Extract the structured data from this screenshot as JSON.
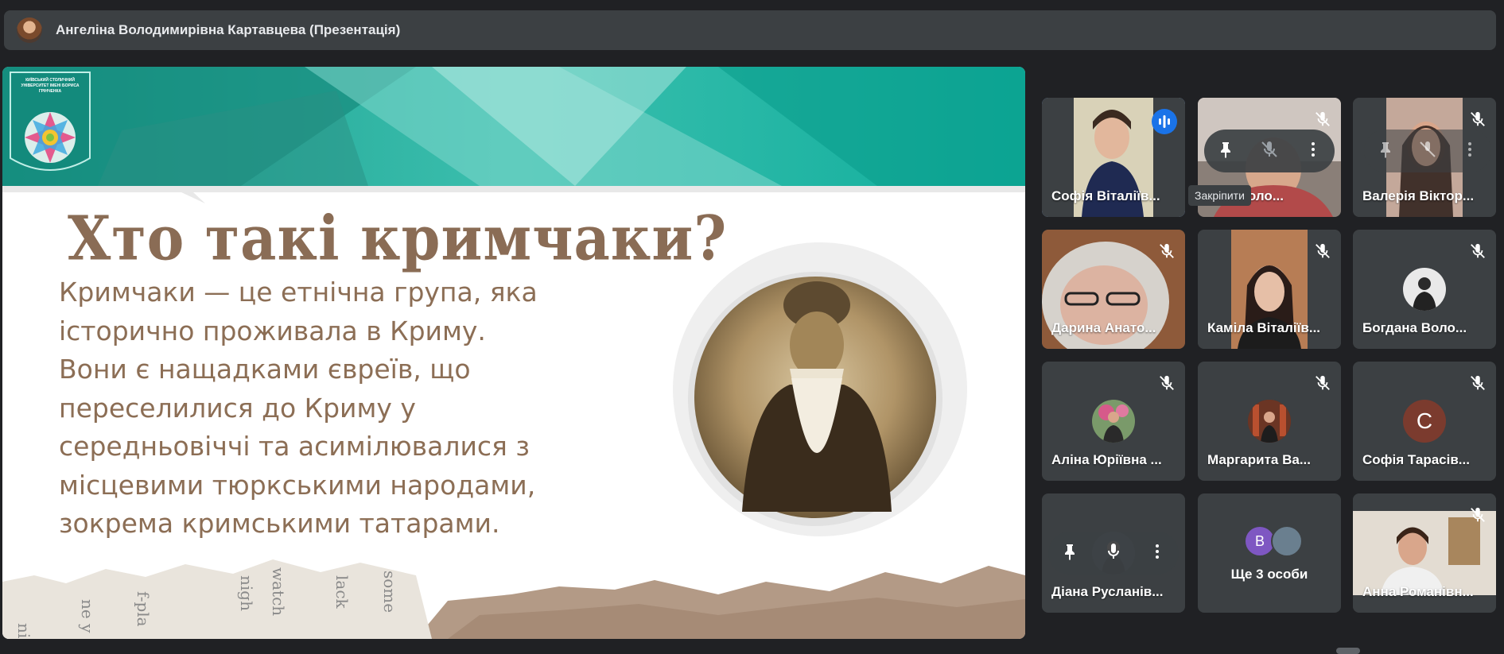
{
  "header": {
    "presenter_title": "Ангеліна Володимирівна Картавцева (Презентація)"
  },
  "slide": {
    "university_name": "КИЇВСЬКИЙ СТОЛИЧНИЙ УНІВЕРСИТЕТ ІМЕНІ БОРИСА ГРІНЧЕНКА",
    "title": "Хто такі кримчаки?",
    "body_lines": [
      "Кримчаки — це етнічна група, яка",
      "історично проживала в Криму.",
      "Вони є нащадками євреїв, що",
      "переселилися до Криму у",
      "середньовіччі та асимілювалися з",
      "місцевими тюркськими народами,",
      "зокрема кримськими татарами."
    ]
  },
  "participants": [
    {
      "name": "Софія Віталіїв...",
      "state": "speaking"
    },
    {
      "name": "...на Воло...",
      "state": "muted"
    },
    {
      "name": "Валерія Віктор...",
      "state": "muted"
    },
    {
      "name": "Дарина Анато...",
      "state": "muted"
    },
    {
      "name": "Каміла Віталіїв...",
      "state": "muted"
    },
    {
      "name": "Богдана Воло...",
      "state": "muted"
    },
    {
      "name": "Аліна Юріївна ...",
      "state": "muted"
    },
    {
      "name": "Маргарита Ва...",
      "state": "muted"
    },
    {
      "name": "Софія Тарасів...",
      "state": "muted",
      "avatar_letter": "С"
    },
    {
      "name": "Діана Русланів...",
      "state": "muted"
    },
    {
      "name": "Анна Романівн...",
      "state": "muted"
    }
  ],
  "more_people": {
    "label": "Ще 3 особи",
    "avatar_letter": "В"
  },
  "tooltip": {
    "pin": "Закріпити"
  },
  "colors": {
    "accent_blue": "#8ab4f8",
    "speaking_blue": "#1a73e8",
    "tile_bg": "#3c4043",
    "text_brown": "#8c6e55"
  },
  "icons": [
    "mic-off-icon",
    "pin-icon",
    "more-vert-icon",
    "audio-wave-icon",
    "mic-icon"
  ]
}
